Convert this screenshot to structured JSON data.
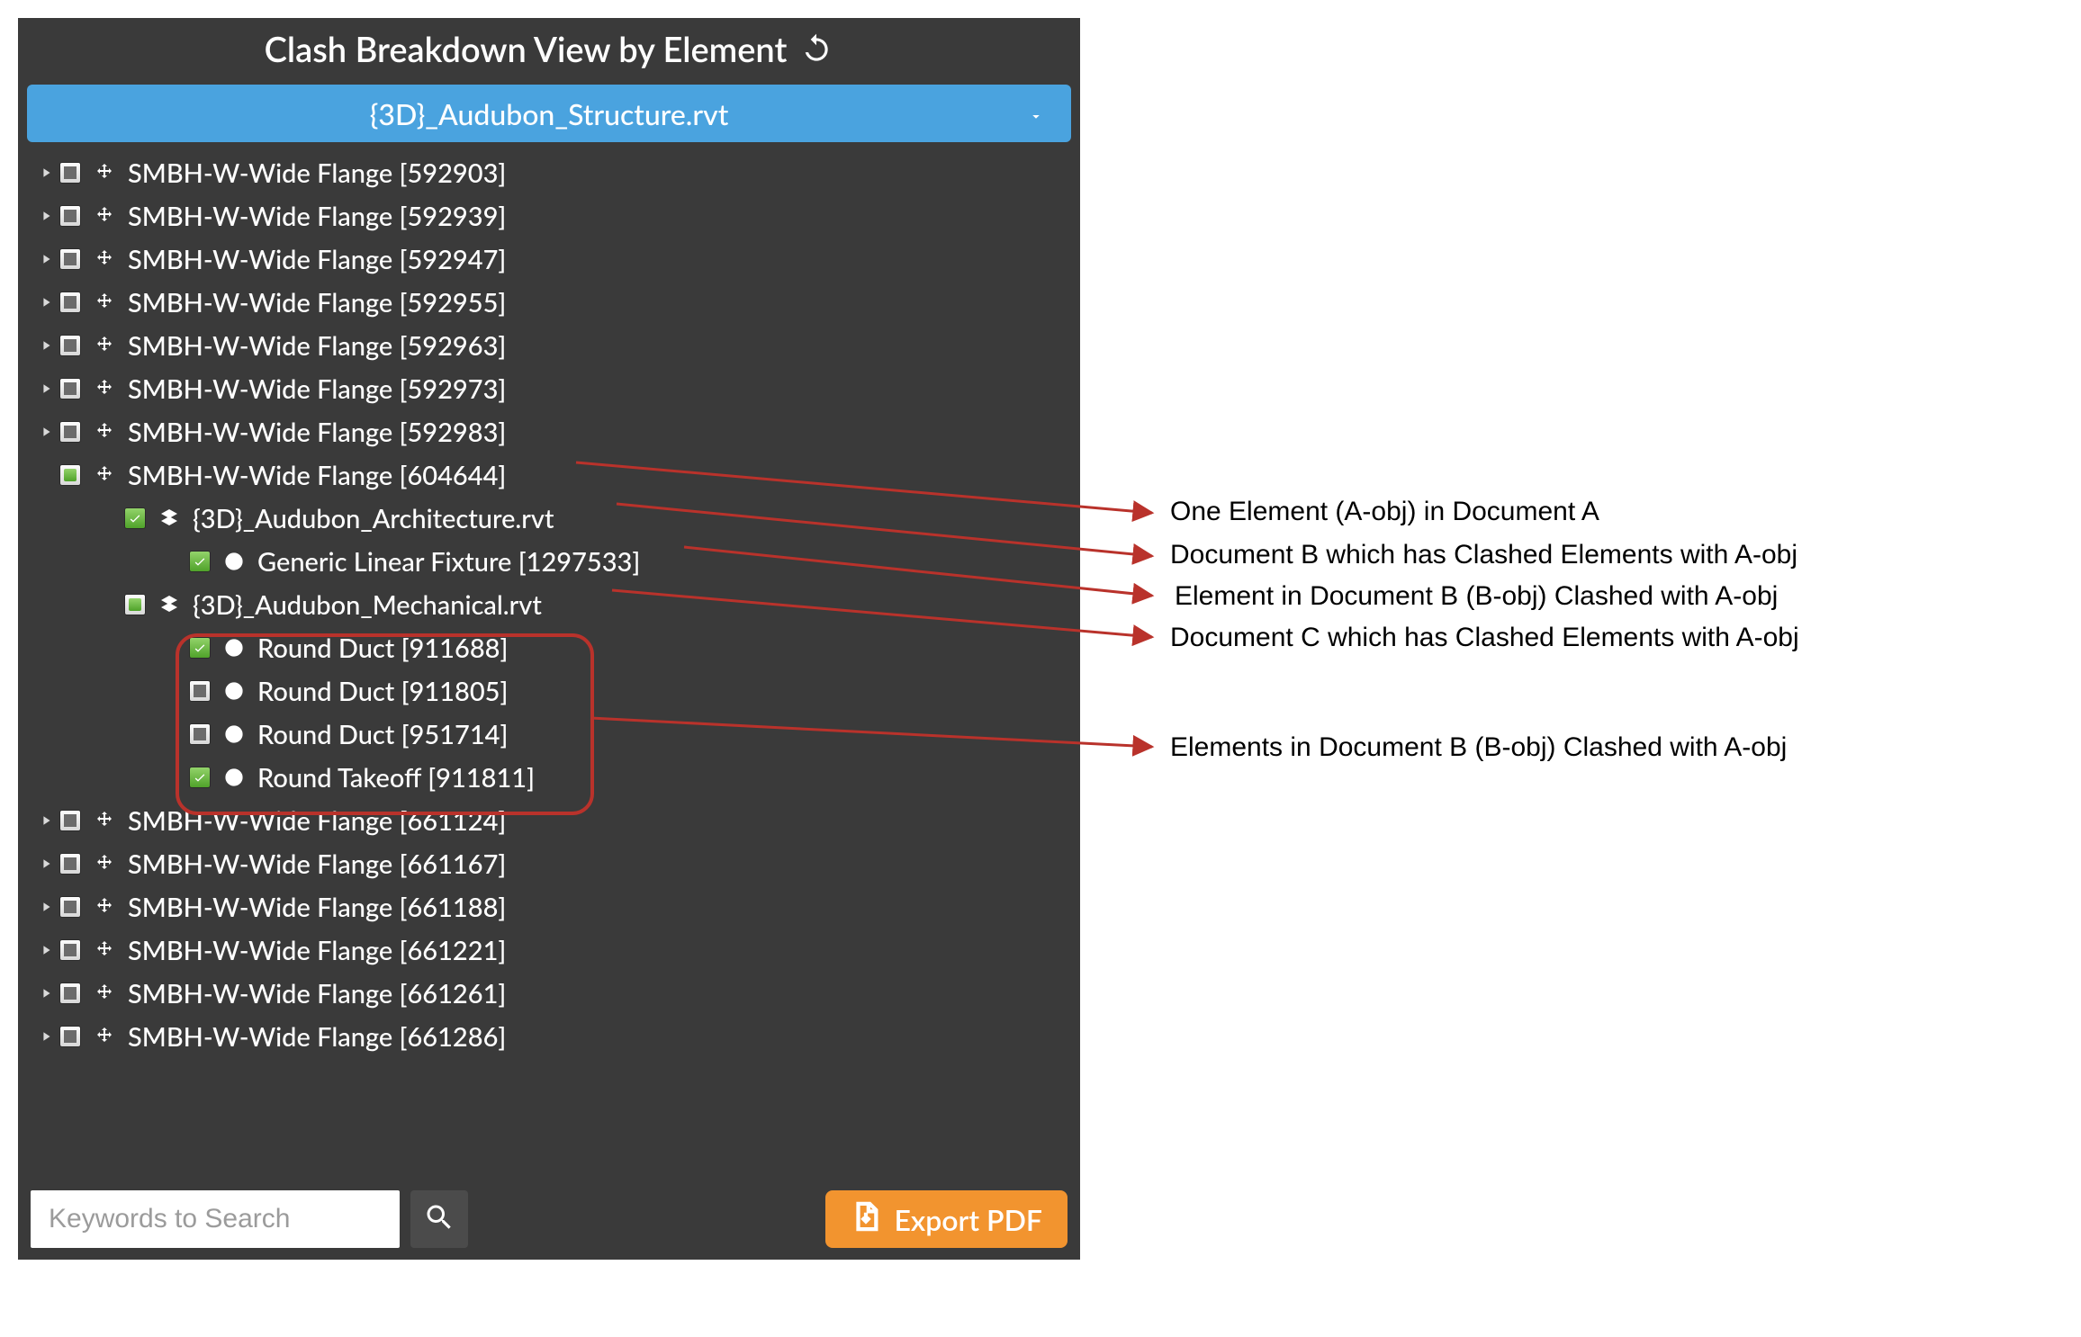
{
  "header": {
    "title": "Clash Breakdown View by Element"
  },
  "dropdown": {
    "selected": "{3D}_Audubon_Structure.rvt"
  },
  "tree": {
    "rows": [
      {
        "level": 0,
        "expand": "closed",
        "check": "tristate",
        "icon": "move",
        "label": "SMBH-W-Wide Flange [592903]"
      },
      {
        "level": 0,
        "expand": "closed",
        "check": "tristate",
        "icon": "move",
        "label": "SMBH-W-Wide Flange [592939]"
      },
      {
        "level": 0,
        "expand": "closed",
        "check": "tristate",
        "icon": "move",
        "label": "SMBH-W-Wide Flange [592947]"
      },
      {
        "level": 0,
        "expand": "closed",
        "check": "tristate",
        "icon": "move",
        "label": "SMBH-W-Wide Flange [592955]"
      },
      {
        "level": 0,
        "expand": "closed",
        "check": "tristate",
        "icon": "move",
        "label": "SMBH-W-Wide Flange [592963]"
      },
      {
        "level": 0,
        "expand": "closed",
        "check": "tristate",
        "icon": "move",
        "label": "SMBH-W-Wide Flange [592973]"
      },
      {
        "level": 0,
        "expand": "closed",
        "check": "tristate",
        "icon": "move",
        "label": "SMBH-W-Wide Flange [592983]"
      },
      {
        "level": 0,
        "expand": "none",
        "check": "partial",
        "icon": "move",
        "label": "SMBH-W-Wide Flange [604644]"
      },
      {
        "level": 1,
        "expand": "none",
        "check": "checked",
        "icon": "doc",
        "label": "{3D}_Audubon_Architecture.rvt"
      },
      {
        "level": 2,
        "expand": "none",
        "check": "checked",
        "icon": "clash",
        "label": "Generic Linear Fixture [1297533]"
      },
      {
        "level": 1,
        "expand": "none",
        "check": "partial",
        "icon": "doc",
        "label": "{3D}_Audubon_Mechanical.rvt"
      },
      {
        "level": 2,
        "expand": "none",
        "check": "checked",
        "icon": "clash",
        "label": "Round Duct [911688]"
      },
      {
        "level": 2,
        "expand": "none",
        "check": "tristate",
        "icon": "clash",
        "label": "Round Duct [911805]"
      },
      {
        "level": 2,
        "expand": "none",
        "check": "tristate",
        "icon": "clash",
        "label": "Round Duct [951714]"
      },
      {
        "level": 2,
        "expand": "none",
        "check": "checked",
        "icon": "clash",
        "label": "Round Takeoff [911811]"
      },
      {
        "level": 0,
        "expand": "closed",
        "check": "tristate",
        "icon": "move",
        "label": "SMBH-W-Wide Flange [661124]"
      },
      {
        "level": 0,
        "expand": "closed",
        "check": "tristate",
        "icon": "move",
        "label": "SMBH-W-Wide Flange [661167]"
      },
      {
        "level": 0,
        "expand": "closed",
        "check": "tristate",
        "icon": "move",
        "label": "SMBH-W-Wide Flange [661188]"
      },
      {
        "level": 0,
        "expand": "closed",
        "check": "tristate",
        "icon": "move",
        "label": "SMBH-W-Wide Flange [661221]"
      },
      {
        "level": 0,
        "expand": "closed",
        "check": "tristate",
        "icon": "move",
        "label": "SMBH-W-Wide Flange [661261]"
      },
      {
        "level": 0,
        "expand": "closed",
        "check": "tristate",
        "icon": "move",
        "label": "SMBH-W-Wide Flange [661286]"
      }
    ]
  },
  "footer": {
    "search_placeholder": "Keywords to Search",
    "export_label": "Export PDF"
  },
  "annotations": [
    {
      "text": "One Element (A-obj) in Document A"
    },
    {
      "text": "Document B which has Clashed Elements with A-obj"
    },
    {
      "text": "Element in Document B (B-obj) Clashed with A-obj"
    },
    {
      "text": "Document C which has Clashed Elements with A-obj"
    },
    {
      "text": "Elements in Document B (B-obj) Clashed with A-obj"
    }
  ],
  "colors": {
    "panel_bg": "#3a3a3a",
    "dropdown_bg": "#4aa3df",
    "export_bg": "#f2942f",
    "callout": "#b9322b",
    "check_green": "#5fb233"
  }
}
